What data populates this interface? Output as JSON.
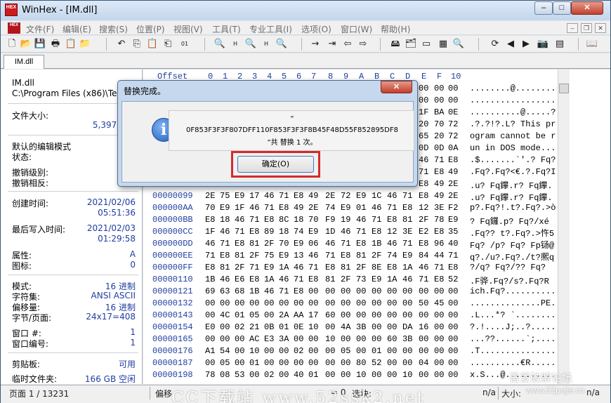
{
  "window": {
    "title": "WinHex - [IM.dll]",
    "logo": "HEX",
    "minimize": "–",
    "maximize": "□",
    "close": "✕"
  },
  "menu": {
    "logo": "HEX",
    "items": [
      "文件(F)",
      "编辑(E)",
      "搜索(S)",
      "位置(P)",
      "视图(V)",
      "工具(T)",
      "专业工具(I)",
      "选项(O)",
      "窗口(W)",
      "帮助(H)"
    ],
    "mdi_minimize": "–",
    "mdi_restore": "❐",
    "mdi_close": "✕"
  },
  "toolbar": {
    "icons": [
      "new-file-icon",
      "open-file-icon",
      "save-icon",
      "print-icon",
      "properties-icon",
      "open-disk-icon",
      "undo-icon",
      "copy-icon",
      "paste-icon",
      "paste-block-icon",
      "write-icon",
      "find-text-icon",
      "find-hex-icon",
      "replace-text-icon",
      "replace-hex-icon",
      "find-next-icon",
      "goto-offset-icon",
      "go-to-icon",
      "back-icon",
      "forward-icon",
      "disk-editor-icon",
      "ram-editor-icon",
      "tape-icon",
      "calculator-icon",
      "analyze-icon",
      "refresh-icon",
      "prev-icon",
      "next-icon",
      "snapshot-icon",
      "table-icon",
      "help-book-icon"
    ],
    "glyphs": [
      "🗋",
      "📂",
      "💾",
      "🖶",
      "📋",
      "📁",
      "↶",
      "⎘",
      "📋",
      "⎗",
      "01",
      "🔍",
      "H",
      "🔍",
      "H",
      "🔍",
      "→",
      "⇥",
      "⇦",
      "⇨",
      "🖴",
      "🗂",
      "▭",
      "▦",
      "🔍",
      "⟳",
      "◀",
      "▶",
      "📷",
      "▤",
      "📖"
    ]
  },
  "tab": {
    "label": "IM.dll"
  },
  "info": {
    "filename": "IM.dll",
    "path": "C:\\Program Files (x86)\\Tence",
    "file_size_label": "文件大小:",
    "file_size_short": "5.",
    "file_size_bytes": "5,397,992",
    "edit_mode_label": "默认的编辑模式",
    "state_label": "状态:",
    "state_value": "已",
    "undo_level_label": "撤销级别:",
    "undo_reverse_label": "撤销相反:",
    "created_label": "创建时间:",
    "created_date": "2021/02/06",
    "created_time": "05:51:36",
    "written_label": "最后写入时间:",
    "written_date": "2021/02/03",
    "written_time": "01:29:58",
    "attr_label": "属性:",
    "attr_value": "A",
    "icon_label": "图标:",
    "icon_value": "0",
    "mode_label": "模式:",
    "mode_value": "16 进制",
    "charset_label": "字符集:",
    "charset_value": "ANSI ASCII",
    "offsets_label": "偏移量:",
    "offsets_value": "16 进制",
    "bytes_page_label": "字节/页面:",
    "bytes_page_value": "24x17=408",
    "window_num_label": "窗口 #:",
    "window_num_value": "1",
    "window_count_label": "窗口编号:",
    "window_count_value": "1",
    "clipboard_label": "剪贴板:",
    "clipboard_value": "可用",
    "temp_label": "临时文件夹:",
    "temp_value": "166 GB 空闲"
  },
  "hex": {
    "header_offset": "Offset",
    "header_cols": [
      "0",
      "1",
      "2",
      "3",
      "4",
      "5",
      "6",
      "7",
      "8",
      "9",
      "A",
      "B",
      "C",
      "D",
      "E",
      "F",
      "10"
    ],
    "rows": [
      {
        "offset": "00000000",
        "bytes": [
          "",
          "",
          "",
          "",
          "",
          "",
          "",
          "",
          "",
          "",
          "",
          "",
          "00",
          "00",
          "00",
          "00",
          "00"
        ],
        "ascii": "........@........."
      },
      {
        "offset": "00000011",
        "bytes": [
          "",
          "",
          "",
          "",
          "",
          "",
          "",
          "",
          "",
          "",
          "",
          "",
          "00",
          "00",
          "00",
          "00",
          "00"
        ],
        "ascii": ".................."
      },
      {
        "offset": "00000022",
        "bytes": [
          "",
          "",
          "",
          "",
          "",
          "",
          "",
          "",
          "",
          "",
          "",
          "",
          "00",
          "00",
          "1F",
          "BA",
          "0E"
        ],
        "ascii": "..........@.....?."
      },
      {
        "offset": "00000033",
        "bytes": [
          "",
          "",
          "",
          "",
          "",
          "",
          "",
          "",
          "",
          "",
          "",
          "",
          "20",
          "20",
          "20",
          "70",
          "72"
        ],
        "ascii": ".?.?!?.L? This pr"
      },
      {
        "offset": "00000044",
        "bytes": [
          "",
          "",
          "",
          "",
          "",
          "",
          "",
          "",
          "",
          "",
          "",
          "",
          "20",
          "20",
          "65",
          "20",
          "72"
        ],
        "ascii": "ogram cannot be r"
      },
      {
        "offset": "00000055",
        "bytes": [
          "",
          "",
          "",
          "",
          "",
          "",
          "",
          "",
          "",
          "",
          "",
          "",
          "20",
          "20",
          "0D",
          "0D",
          "0A"
        ],
        "ascii": "un in DOS mode..."
      },
      {
        "offset": "00000066",
        "bytes": [
          "",
          "",
          "",
          "",
          "",
          "",
          "",
          "",
          "",
          "",
          "",
          "",
          "00",
          "00",
          "46",
          "71",
          "E8"
        ],
        "ascii": ".$.......`'.? Fq?"
      },
      {
        "offset": "00000077",
        "bytes": [
          "",
          "",
          "",
          "",
          "",
          "",
          "",
          "",
          "",
          "",
          "",
          "",
          "E8",
          "49",
          "71",
          "E8",
          "49"
        ],
        "ascii": ".Fq?.Fq?<€.?.Fq?I"
      },
      {
        "offset": "00000088",
        "bytes": [
          "",
          "",
          "",
          "",
          "",
          "",
          "",
          "",
          "",
          "",
          "",
          "",
          "46",
          "71",
          "E8",
          "49",
          "2E"
        ],
        "ascii": ".u? Fq鑻.r? Fq鑻."
      },
      {
        "offset": "00000099",
        "bytes": [
          "2E",
          "75",
          "E9",
          "17",
          "46",
          "71",
          "E8",
          "49",
          "2E",
          "72",
          "E9",
          "1C",
          "46",
          "71",
          "E8",
          "49",
          "2E"
        ],
        "ascii": ".u? Fq鑻.r? Fq鑻."
      },
      {
        "offset": "000000AA",
        "bytes": [
          "70",
          "E9",
          "1F",
          "46",
          "71",
          "E8",
          "49",
          "2E",
          "74",
          "E9",
          "01",
          "46",
          "71",
          "E8",
          "12",
          "3E",
          "F2"
        ],
        "ascii": "p?.Fq?!.t?.Fq?.>ò"
      },
      {
        "offset": "000000BB",
        "bytes": [
          "E8",
          "18",
          "46",
          "71",
          "E8",
          "8C",
          "18",
          "70",
          "F9",
          "19",
          "46",
          "71",
          "E8",
          "81",
          "2F",
          "78",
          "E9"
        ],
        "ascii": "? Fq鑼.p? Fq?/xé"
      },
      {
        "offset": "000000CC",
        "bytes": [
          "1F",
          "46",
          "71",
          "E8",
          "89",
          "18",
          "74",
          "E9",
          "1D",
          "46",
          "71",
          "E8",
          "12",
          "3E",
          "E2",
          "E8",
          "35"
        ],
        "ascii": ".Fq?? t?.Fq?.>忤5"
      },
      {
        "offset": "000000DD",
        "bytes": [
          "46",
          "71",
          "E8",
          "81",
          "2F",
          "70",
          "E9",
          "06",
          "46",
          "71",
          "E8",
          "1B",
          "46",
          "71",
          "E8",
          "96",
          "40"
        ],
        "ascii": "Fq? /p? Fq? Fp铴@"
      },
      {
        "offset": "000000EE",
        "bytes": [
          "71",
          "E8",
          "81",
          "2F",
          "75",
          "E9",
          "13",
          "46",
          "71",
          "E8",
          "81",
          "2F",
          "74",
          "E9",
          "84",
          "44",
          "71"
        ],
        "ascii": "q?./u?.Fq?./t?熈q"
      },
      {
        "offset": "000000FF",
        "bytes": [
          "E8",
          "81",
          "2F",
          "71",
          "E9",
          "1A",
          "46",
          "71",
          "E8",
          "81",
          "2F",
          "8E",
          "E8",
          "1A",
          "46",
          "71",
          "E8"
        ],
        "ascii": "?/q? Fq?/?? Fq?"
      },
      {
        "offset": "00000110",
        "bytes": [
          "1B",
          "46",
          "E6",
          "E8",
          "1A",
          "46",
          "71",
          "E8",
          "81",
          "2F",
          "73",
          "E9",
          "1A",
          "46",
          "71",
          "E8",
          "52"
        ],
        "ascii": ".F骅.Fq?/s?.Fq?R"
      },
      {
        "offset": "00000121",
        "bytes": [
          "69",
          "63",
          "68",
          "1B",
          "46",
          "71",
          "E8",
          "00",
          "00",
          "00",
          "00",
          "00",
          "00",
          "00",
          "00",
          "00",
          "00"
        ],
        "ascii": "ich.Fq?.........."
      },
      {
        "offset": "00000132",
        "bytes": [
          "00",
          "00",
          "00",
          "00",
          "00",
          "00",
          "00",
          "00",
          "00",
          "00",
          "00",
          "00",
          "00",
          "00",
          "50",
          "45",
          "00"
        ],
        "ascii": "..............PE."
      },
      {
        "offset": "00000143",
        "bytes": [
          "00",
          "4C",
          "01",
          "05",
          "00",
          "2A",
          "AA",
          "17",
          "60",
          "00",
          "00",
          "00",
          "00",
          "00",
          "00",
          "00",
          "00"
        ],
        "ascii": ".L...*? `........"
      },
      {
        "offset": "00000154",
        "bytes": [
          "E0",
          "00",
          "02",
          "21",
          "0B",
          "01",
          "0E",
          "10",
          "00",
          "4A",
          "3B",
          "00",
          "00",
          "DA",
          "16",
          "00",
          "00"
        ],
        "ascii": "?.!....J;..?....."
      },
      {
        "offset": "00000165",
        "bytes": [
          "00",
          "00",
          "00",
          "AC",
          "E3",
          "3A",
          "00",
          "00",
          "10",
          "00",
          "00",
          "00",
          "60",
          "3B",
          "00",
          "00",
          "00"
        ],
        "ascii": "...??......`;....."
      },
      {
        "offset": "00000176",
        "bytes": [
          "A1",
          "54",
          "00",
          "10",
          "00",
          "00",
          "02",
          "00",
          "00",
          "05",
          "00",
          "01",
          "00",
          "00",
          "00",
          "00",
          "00"
        ],
        "ascii": ".T..............."
      },
      {
        "offset": "00000187",
        "bytes": [
          "00",
          "05",
          "00",
          "01",
          "00",
          "00",
          "00",
          "00",
          "00",
          "00",
          "80",
          "52",
          "00",
          "00",
          "04",
          "00",
          "00"
        ],
        "ascii": "..........€R....."
      },
      {
        "offset": "00000198",
        "bytes": [
          "78",
          "08",
          "53",
          "00",
          "02",
          "00",
          "40",
          "01",
          "00",
          "00",
          "10",
          "00",
          "00",
          "10",
          "00",
          "00",
          "00"
        ],
        "ascii": "x.S...@.........."
      }
    ]
  },
  "status": {
    "page": "页面 1 / 13231",
    "offset_label": "偏移",
    "value": "= 0",
    "selection": "选块:",
    "na1": "n/a",
    "size_label": "大小:",
    "na2": "n/a"
  },
  "watermarks": {
    "main": "CC下载站 www.52ssk2.net",
    "forum": "吾爱破解论坛",
    "forum_url": "www.52pojie.cn"
  },
  "dialog": {
    "title": "替换完成。",
    "close": "✕",
    "icon": "i",
    "quote_open": "“",
    "hex_string": "0F853F3F3F807DFF110F853F3F3F8B45F48D55F852895DF8",
    "result": "”共 替换 1 次。",
    "ok_label": "确定(O)"
  }
}
